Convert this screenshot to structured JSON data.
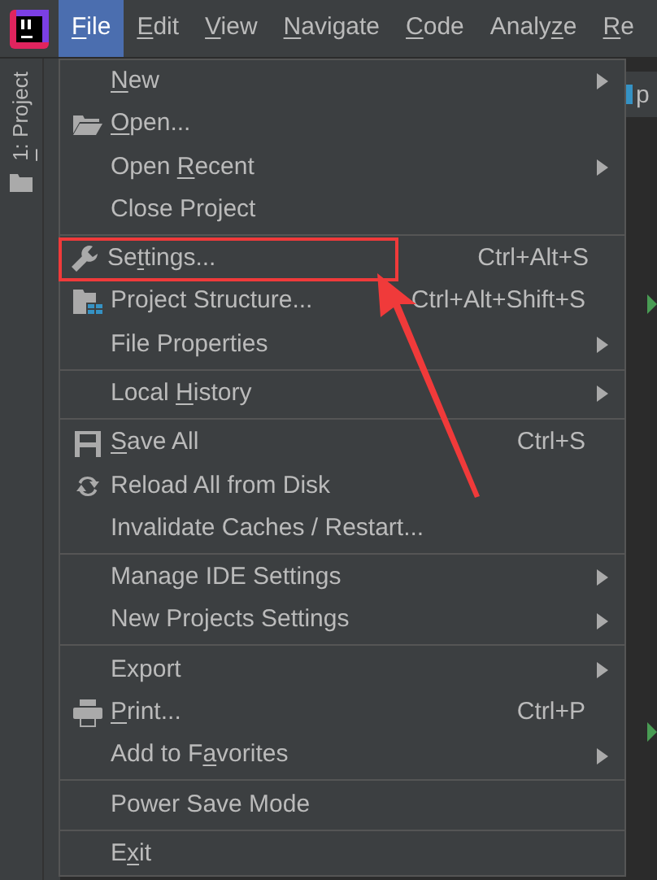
{
  "menu_bar": [
    {
      "label": {
        "key": "F",
        "post": "ile"
      },
      "selected": true
    },
    {
      "label": {
        "key": "E",
        "post": "dit"
      },
      "selected": false
    },
    {
      "label": {
        "key": "V",
        "post": "iew"
      },
      "selected": false
    },
    {
      "label": {
        "key": "N",
        "post": "avigate"
      },
      "selected": false
    },
    {
      "label": {
        "key": "C",
        "post": "ode"
      },
      "selected": false
    },
    {
      "label": {
        "pre": "Analy",
        "key": "z",
        "post": "e"
      },
      "selected": false
    },
    {
      "label": {
        "key": "R",
        "post": "e"
      },
      "selected": false
    }
  ],
  "tool_strip": {
    "label": {
      "key": "1",
      "post": ": Project"
    }
  },
  "editor_tab": {
    "label": "p"
  },
  "file_menu": {
    "groups": [
      [
        {
          "label": {
            "key": "N",
            "post": "ew"
          },
          "submenu": true,
          "highlighted": false
        },
        {
          "label": {
            "key": "O",
            "post": "pen..."
          },
          "submenu": false,
          "highlighted": false
        },
        {
          "label": {
            "pre": "Open ",
            "key": "R",
            "post": "ecent"
          },
          "submenu": true,
          "highlighted": false
        },
        {
          "label": {
            "pre": "Close Project"
          },
          "submenu": false,
          "highlighted": false
        }
      ],
      [
        {
          "label": {
            "pre": "Se",
            "key": "t",
            "post": "tings..."
          },
          "shortcut": "Ctrl+Alt+S",
          "submenu": false,
          "highlighted": true
        },
        {
          "label": {
            "pre": "Project Structure..."
          },
          "shortcut": "Ctrl+Alt+Shift+S",
          "submenu": false,
          "highlighted": false
        },
        {
          "label": {
            "pre": "File Properties"
          },
          "submenu": true,
          "highlighted": false
        }
      ],
      [
        {
          "label": {
            "pre": "Local ",
            "key": "H",
            "post": "istory"
          },
          "submenu": true,
          "highlighted": false
        }
      ],
      [
        {
          "label": {
            "key": "S",
            "post": "ave All"
          },
          "shortcut": "Ctrl+S",
          "submenu": false,
          "highlighted": false
        },
        {
          "label": {
            "pre": "Reload All from Disk"
          },
          "submenu": false,
          "highlighted": false
        },
        {
          "label": {
            "pre": "Invalidate Caches / Restart..."
          },
          "submenu": false,
          "highlighted": false
        }
      ],
      [
        {
          "label": {
            "pre": "Manage IDE Settings"
          },
          "submenu": true,
          "highlighted": false
        },
        {
          "label": {
            "pre": "New Projects Settings"
          },
          "submenu": true,
          "highlighted": false
        }
      ],
      [
        {
          "label": {
            "pre": "Export"
          },
          "submenu": true,
          "highlighted": false
        },
        {
          "label": {
            "key": "P",
            "post": "rint..."
          },
          "shortcut": "Ctrl+P",
          "submenu": false,
          "highlighted": false
        },
        {
          "label": {
            "pre": "Add to F",
            "key": "a",
            "post": "vorites"
          },
          "submenu": true,
          "highlighted": false
        }
      ],
      [
        {
          "label": {
            "pre": "Power Save Mode"
          },
          "submenu": false,
          "highlighted": false
        }
      ],
      [
        {
          "label": {
            "pre": "E",
            "key": "x",
            "post": "it"
          },
          "submenu": false,
          "highlighted": false
        }
      ]
    ]
  }
}
